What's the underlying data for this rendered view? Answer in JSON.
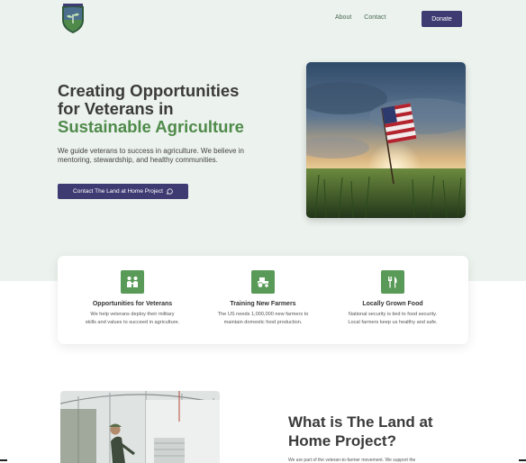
{
  "header": {
    "logo_icon": "seedling-shield-logo",
    "nav": [
      {
        "label": "About"
      },
      {
        "label": "Contact"
      }
    ],
    "donate_label": "Donate"
  },
  "hero": {
    "title_line1": "Creating Opportunities",
    "title_line2": "for Veterans in",
    "title_accent": "Sustainable Agriculture",
    "lead": "We guide veterans to success in agriculture.  We believe in mentoring, stewardship, and healthy communities.",
    "cta_label": "Contact The Land at Home Project",
    "cta_icon": "chat-bubble-icon",
    "image_icon": "american-flag-field-photo"
  },
  "features": [
    {
      "icon": "people-icon",
      "title": "Opportunities for Veterans",
      "line1": "We help veterans deploy their military",
      "line2": "skills and values to succeed in agriculture."
    },
    {
      "icon": "tractor-icon",
      "title": "Training New Farmers",
      "line1": "The US needs 1,000,000 new farmers to",
      "line2": "maintain domestic food production."
    },
    {
      "icon": "fork-knife-icon",
      "title": "Locally Grown Food",
      "line1": "National security is tied to food security.",
      "line2": "Local farmers keep us healthy and safe."
    }
  ],
  "about": {
    "title": "What is The Land at Home Project?",
    "text": "We are part of the veteran-to-farmer movement. We support the",
    "image_icon": "greenhouse-farmer-photo"
  },
  "colors": {
    "brand_purple": "#3e3a72",
    "accent_green": "#4f8a4a",
    "icon_green": "#5a9a58",
    "hero_bg": "#ecf2ed"
  }
}
